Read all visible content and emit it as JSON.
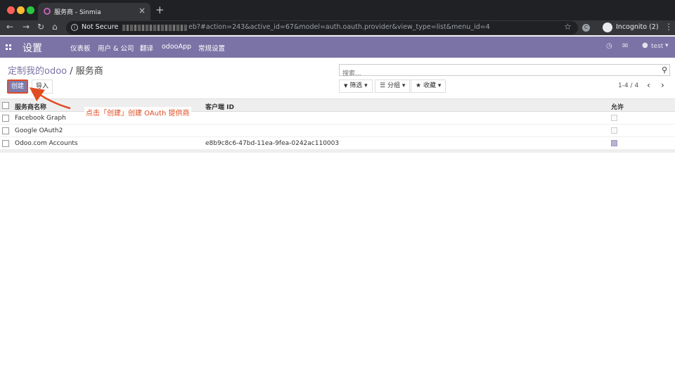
{
  "browser": {
    "tab_title": "服务商 - Sinmia",
    "tab_close": "×",
    "new_tab": "+",
    "not_secure": "Not Secure",
    "url": "eb?#action=243&active_id=67&model=auth.oauth.provider&view_type=list&menu_id=4",
    "incognito": "Incognito (2)",
    "back": "←",
    "forward": "→",
    "reload": "↻",
    "home": "⌂",
    "star": "☆",
    "kebab": "⋮",
    "ext": "C",
    "info": "i"
  },
  "navbar": {
    "brand": "设置",
    "menu": [
      "仪表板",
      "用户 & 公司",
      "翻译",
      "odooApp",
      "常规设置"
    ],
    "user": "test",
    "user_caret": "▾",
    "activity_icon": "◷",
    "chat_icon": "✉"
  },
  "breadcrumb": {
    "parent": "定制我的odoo",
    "sep": " / ",
    "current": "服务商"
  },
  "search": {
    "placeholder": "搜索...",
    "icon": "⚲"
  },
  "buttons": {
    "create": "创建",
    "import": "导入"
  },
  "filters": [
    {
      "icon": "▼",
      "label": "筛选",
      "caret": "▾"
    },
    {
      "icon": "☰",
      "label": "分组",
      "caret": "▾"
    },
    {
      "icon": "★",
      "label": "收藏",
      "caret": "▾"
    }
  ],
  "pager": {
    "value": "1-4 / 4",
    "prev": "‹",
    "next": "›"
  },
  "table": {
    "columns": [
      "服务商名称",
      "客户端 ID",
      "允许"
    ],
    "rows": [
      {
        "name": "Facebook Graph",
        "client_id": "",
        "allowed": false
      },
      {
        "name": "Google OAuth2",
        "client_id": "",
        "allowed": false
      },
      {
        "name": "Odoo.com Accounts",
        "client_id": "e8b9c8c6-47bd-11ea-9fea-0242ac110003",
        "allowed": true
      }
    ]
  },
  "annotation": "点击「创建」创建 OAuth 提供商",
  "colors": {
    "navbar": "#7b73a5",
    "accent": "#7c7bad",
    "annotation": "#e04b22"
  }
}
